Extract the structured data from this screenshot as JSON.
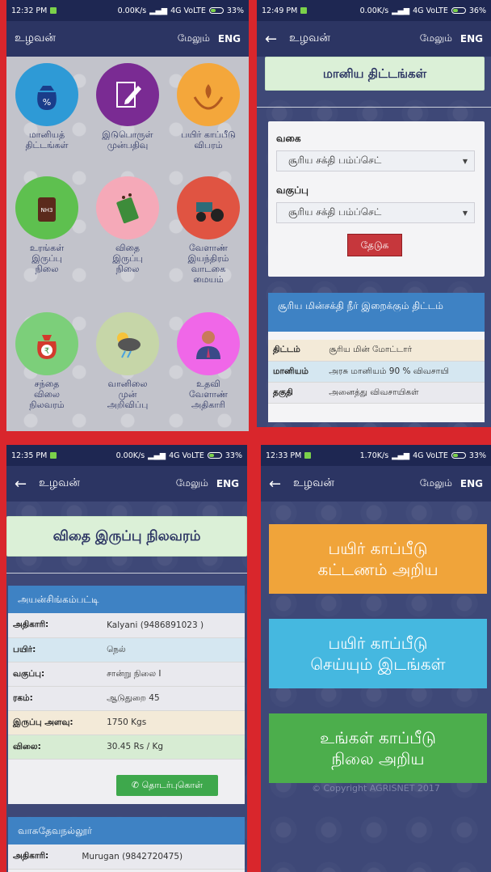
{
  "colors": {
    "separator": "#d9262c",
    "panel_bg": "#3e4877",
    "appbar": "#2c3563",
    "statusbar": "#1e2752",
    "green_title": "#dbf0d7",
    "blue_header": "#3e82c4",
    "search_button": "#c6373c",
    "call_button": "#3ea84c",
    "btn_orange": "#f0a43a",
    "btn_cyan": "#45b8e0",
    "btn_green": "#4cae4c"
  },
  "panel1": {
    "status": {
      "time": "12:32 PM",
      "speed": "0.00K/s",
      "net": "4G VoLTE",
      "battery": "33%"
    },
    "appbar": {
      "title": "உழவன்",
      "more": "மேலும்",
      "lang": "ENG"
    },
    "tiles": [
      {
        "label1": "மானியத்",
        "label2": "திட்டங்கள்",
        "label3": "",
        "label4": "",
        "icon": "subsidy-bag-icon",
        "color": "#2e9ad6"
      },
      {
        "label1": "இடுபொருள்",
        "label2": "முன்பதிவு",
        "label3": "",
        "label4": "",
        "icon": "booking-pencil-icon",
        "color": "#7a2b93"
      },
      {
        "label1": "பயிர் காப்பீடு",
        "label2": "விபரம்",
        "label3": "",
        "label4": "",
        "icon": "crop-hands-icon",
        "color": "#f4a73b"
      },
      {
        "label1": "உரங்கள்",
        "label2": "இருப்பு",
        "label3": "நிலை",
        "label4": "",
        "icon": "fertilizer-sack-icon",
        "color": "#5ec04f"
      },
      {
        "label1": "விதை",
        "label2": "இருப்பு",
        "label3": "நிலை",
        "label4": "",
        "icon": "seed-packet-icon",
        "color": "#f5a9b8"
      },
      {
        "label1": "வேளாண்",
        "label2": "இயந்திரம்",
        "label3": "வாடகை",
        "label4": "மையம்",
        "icon": "tractor-icon",
        "color": "#e05442"
      },
      {
        "label1": "சந்தை",
        "label2": "விலை",
        "label3": "நிலவரம்",
        "label4": "",
        "icon": "money-bag-icon",
        "color": "#7ccf7a"
      },
      {
        "label1": "வானிலை",
        "label2": "முன்",
        "label3": "அறிவிப்பு",
        "label4": "",
        "icon": "weather-cloud-icon",
        "color": "#c6d6a8"
      },
      {
        "label1": "உதவி",
        "label2": "வேளாண்",
        "label3": "அதிகாரி",
        "label4": "",
        "icon": "officer-person-icon",
        "color": "#f067e8"
      }
    ]
  },
  "panel2": {
    "status": {
      "time": "12:49 PM",
      "speed": "0.00K/s",
      "net": "4G VoLTE",
      "battery": "36%"
    },
    "appbar": {
      "title": "உழவன்",
      "more": "மேலும்",
      "lang": "ENG"
    },
    "page_title": "மானிய திட்டங்கள்",
    "type_label": "வகை",
    "type_value": "சூரிய சக்தி பம்ப்செட்",
    "category_label": "வகுப்பு",
    "category_value": "சூரிய சக்தி பம்ப்செட்",
    "search_button": "தேடுக",
    "result_title": "சூரிய மின்சக்தி நீர் இறைக்கும் திட்டம்",
    "rows": [
      {
        "k": "திட்டம்",
        "v": "சூரிய மின் மோட்டார்"
      },
      {
        "k": "மானியம்",
        "v": "அரசு மானியம் 90 % விவசாயி"
      },
      {
        "k": "தகுதி",
        "v": "அனைத்து விவசாயிகள்"
      }
    ]
  },
  "panel3": {
    "status": {
      "time": "12:35 PM",
      "speed": "0.00K/s",
      "net": "4G VoLTE",
      "battery": "33%"
    },
    "appbar": {
      "title": "உழவன்",
      "more": "மேலும்",
      "lang": "ENG"
    },
    "page_title": "விதை இருப்பு நிலவரம்",
    "card1": {
      "place": "அயன்சிங்கம்பட்டி",
      "rows": [
        {
          "k": "அதிகாரி:",
          "v": "Kalyani (9486891023 )"
        },
        {
          "k": "பயிர்:",
          "v": "நெல்"
        },
        {
          "k": "வகுப்பு:",
          "v": "சான்று நிலை I"
        },
        {
          "k": "ரகம்:",
          "v": "ஆடுதுறை 45"
        },
        {
          "k": "இருப்பு அளவு:",
          "v": "1750 Kgs"
        },
        {
          "k": "விலை:",
          "v": "30.45 Rs / Kg"
        }
      ],
      "call_button": "தொடர்புகொள்"
    },
    "card2": {
      "place": "வாசுதேவநல்லூர்",
      "rows": [
        {
          "k": "அதிகாரி:",
          "v": "Murugan (9842720475)"
        }
      ]
    }
  },
  "panel4": {
    "status": {
      "time": "12:33 PM",
      "speed": "1.70K/s",
      "net": "4G VoLTE",
      "battery": "33%"
    },
    "appbar": {
      "title": "உழவன்",
      "more": "மேலும்",
      "lang": "ENG"
    },
    "btn1_line1": "பயிர் காப்பீடு",
    "btn1_line2": "கட்டணம் அறிய",
    "btn2_line1": "பயிர் காப்பீடு",
    "btn2_line2": "செய்யும் இடங்கள்",
    "btn3_line1": "உங்கள் காப்பீடு",
    "btn3_line2": "நிலை அறிய",
    "copyright": "© Copyright AGRISNET 2017"
  }
}
